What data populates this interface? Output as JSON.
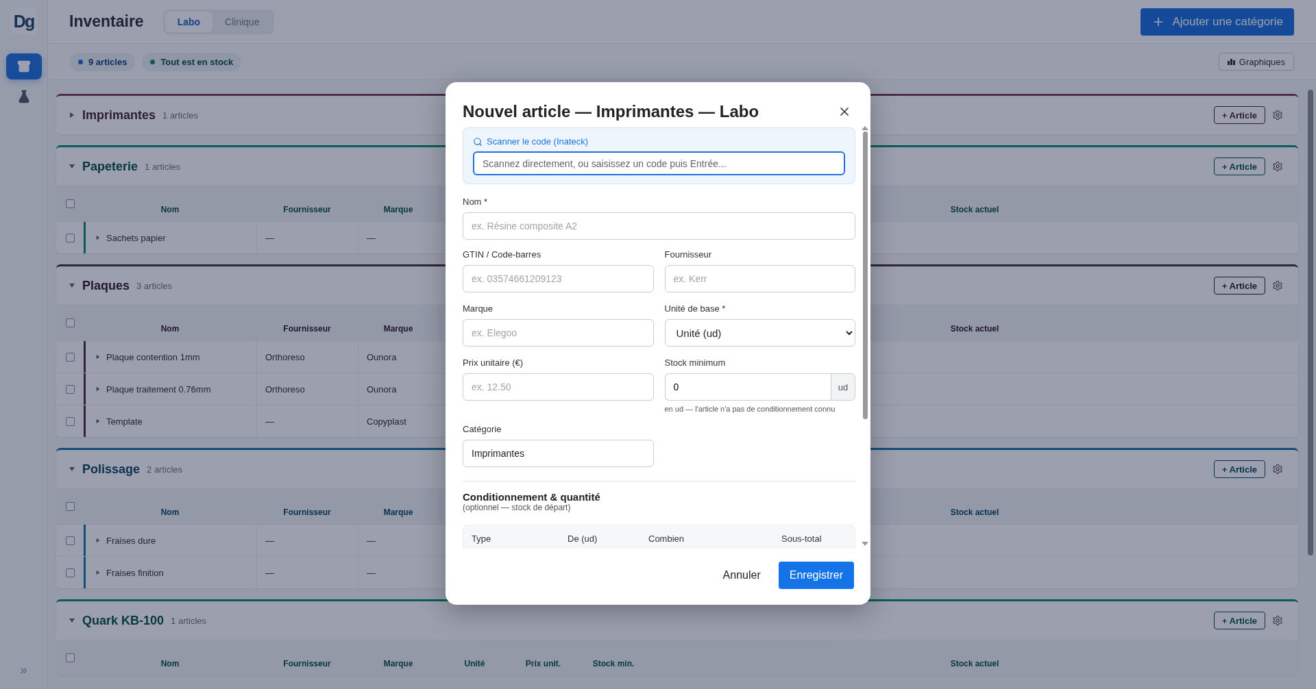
{
  "sidebar": {
    "logo": "Dg",
    "items": [
      {
        "kind": "archive",
        "selected": true
      },
      {
        "kind": "flask",
        "selected": false
      }
    ],
    "expand": "»"
  },
  "header": {
    "title": "Inventaire",
    "tabs": [
      {
        "label": "Labo",
        "selected": true
      },
      {
        "label": "Clinique",
        "selected": false
      }
    ],
    "add_button": "Ajouter une catégorie"
  },
  "toolbar": {
    "chips": [
      {
        "label": "9 articles",
        "color": "#164992"
      },
      {
        "label": "Tout est en stock",
        "color": "#0f5a53"
      }
    ],
    "charts_button": "Graphiques"
  },
  "sections": [
    {
      "name": "Imprimantes",
      "count": "1 articles",
      "color": "#4d2d4b",
      "expanded": false,
      "add_button": "+ Article"
    },
    {
      "name": "Papeterie",
      "count": "1 articles",
      "color": "#0c5a59",
      "expanded": true,
      "add_button": "+ Article",
      "select_all_checked": false,
      "columns": [
        {
          "kind": "name",
          "label": "Nom"
        },
        {
          "kind": "supplier",
          "label": "Fournisseur"
        },
        {
          "kind": "brand",
          "label": "Marque"
        },
        {
          "kind": "stock",
          "label": "Stock actuel"
        }
      ],
      "rows": [
        {
          "checked": false,
          "cells": [
            {
              "kind": "name",
              "text": "Sachets papier"
            },
            {
              "kind": "supplier",
              "text": "—"
            },
            {
              "kind": "brand",
              "text": "—"
            }
          ]
        }
      ]
    },
    {
      "name": "Plaques",
      "count": "3 articles",
      "color": "#30233e",
      "expanded": true,
      "add_button": "+ Article",
      "select_all_checked": false,
      "columns": [
        {
          "kind": "name",
          "label": "Nom"
        },
        {
          "kind": "supplier",
          "label": "Fournisseur"
        },
        {
          "kind": "brand",
          "label": "Marque"
        },
        {
          "kind": "stock",
          "label": "Stock actuel"
        }
      ],
      "rows": [
        {
          "checked": false,
          "cells": [
            {
              "kind": "name",
              "text": "Plaque contention 1mm"
            },
            {
              "kind": "supplier",
              "text": "Orthoreso"
            },
            {
              "kind": "brand",
              "text": "Ounora"
            }
          ]
        },
        {
          "checked": false,
          "cells": [
            {
              "kind": "name",
              "text": "Plaque traitement 0.76mm"
            },
            {
              "kind": "supplier",
              "text": "Orthoreso"
            },
            {
              "kind": "brand",
              "text": "Ounora"
            }
          ]
        },
        {
          "checked": false,
          "cells": [
            {
              "kind": "name",
              "text": "Template"
            },
            {
              "kind": "supplier",
              "text": "—"
            },
            {
              "kind": "brand",
              "text": "Copyplast"
            }
          ]
        }
      ]
    },
    {
      "name": "Polissage",
      "count": "2 articles",
      "color": "#104e78",
      "expanded": true,
      "add_button": "+ Article",
      "select_all_checked": false,
      "columns": [
        {
          "kind": "name",
          "label": "Nom"
        },
        {
          "kind": "supplier",
          "label": "Fournisseur"
        },
        {
          "kind": "brand",
          "label": "Marque"
        },
        {
          "kind": "stock",
          "label": "Stock actuel"
        }
      ],
      "rows": [
        {
          "checked": false,
          "cells": [
            {
              "kind": "name",
              "text": "Fraises dure"
            },
            {
              "kind": "supplier",
              "text": "—"
            },
            {
              "kind": "brand",
              "text": "—"
            }
          ]
        },
        {
          "checked": false,
          "cells": [
            {
              "kind": "name",
              "text": "Fraises finition"
            },
            {
              "kind": "supplier",
              "text": "—"
            },
            {
              "kind": "brand",
              "text": "—"
            }
          ]
        }
      ]
    },
    {
      "name": "Quark KB-100",
      "count": "1 articles",
      "color": "#0c5a59",
      "expanded": true,
      "add_button": "+ Article",
      "select_all_checked": false,
      "columns": [
        {
          "kind": "name",
          "label": "Nom"
        },
        {
          "kind": "supplier",
          "label": "Fournisseur"
        },
        {
          "kind": "brand",
          "label": "Marque"
        },
        {
          "kind": "unit",
          "label": "Unité"
        },
        {
          "kind": "price",
          "label": "Prix unit."
        },
        {
          "kind": "min",
          "label": "Stock min."
        },
        {
          "kind": "stock",
          "label": "Stock actuel"
        }
      ]
    }
  ],
  "dialog": {
    "title": "Nouvel article — Imprimantes — Labo",
    "scanner": {
      "label": "Scanner le code (Inateck)",
      "placeholder": "Scannez directement, ou saisissez un code puis Entrée..."
    },
    "field_rows": [
      [
        {
          "kind": "text",
          "label": "Nom *",
          "placeholder": "ex. Résine composite A2"
        }
      ],
      [
        {
          "kind": "text",
          "label": "GTIN / Code-barres",
          "placeholder": "ex. 03574661209123"
        },
        {
          "kind": "text",
          "label": "Fournisseur",
          "placeholder": "ex. Kerr"
        }
      ],
      [
        {
          "kind": "text",
          "label": "Marque",
          "placeholder": "ex. Elegoo"
        },
        {
          "kind": "select",
          "label": "Unité de base *",
          "value": "Unité (ud)"
        }
      ],
      [
        {
          "kind": "text",
          "label": "Prix unitaire (€)",
          "placeholder": "ex. 12.50"
        },
        {
          "kind": "unit",
          "label": "Stock minimum",
          "value": "0",
          "addon": "ud",
          "help": "en ud — l'article n'a pas de conditionnement connu"
        }
      ],
      [
        {
          "kind": "text",
          "label": "Catégorie",
          "value": "Imprimantes"
        }
      ]
    ],
    "packaging": {
      "title": "Conditionnement & quantité",
      "subtitle": "(optionnel — stock de départ)",
      "columns": [
        "Type",
        "De (ud)",
        "Combien",
        "Sous-total"
      ]
    },
    "cancel": "Annuler",
    "save": "Enregistrer"
  }
}
